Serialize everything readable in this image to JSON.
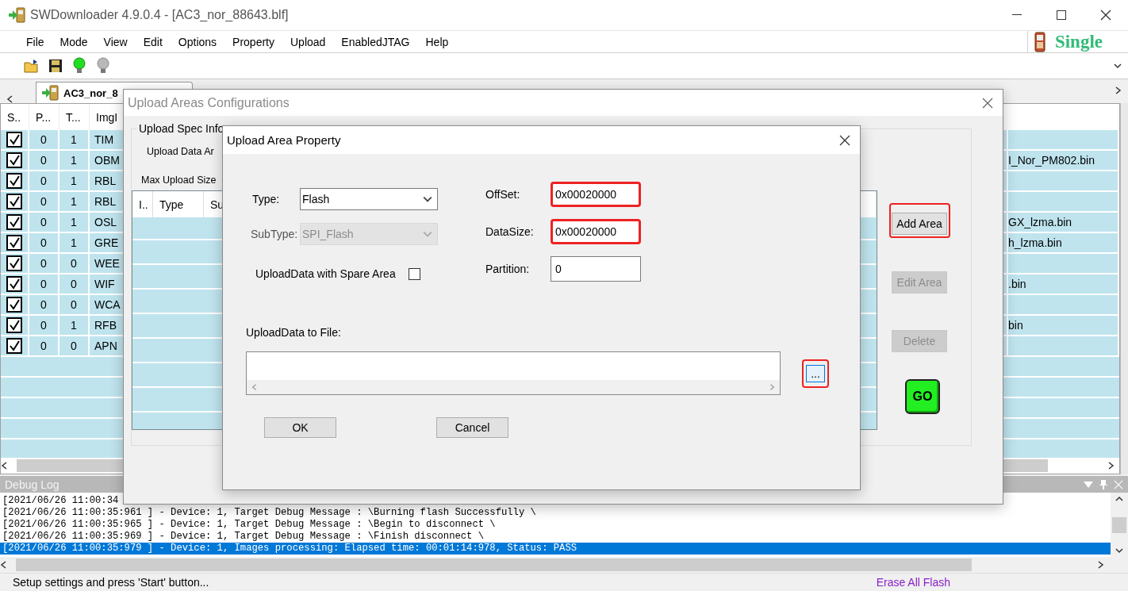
{
  "window": {
    "title": "SWDownloader 4.9.0.4 - [AC3_nor_88643.blf]"
  },
  "menu": [
    "File",
    "Mode",
    "View",
    "Edit",
    "Options",
    "Property",
    "Upload",
    "EnabledJTAG",
    "Help"
  ],
  "mode_label": "Single",
  "tab": {
    "label": "AC3_nor_8",
    "selected": true
  },
  "image_table": {
    "columns": [
      "S..",
      "P...",
      "T...",
      "ImgI"
    ],
    "rows": [
      {
        "checked": true,
        "p": "0",
        "t": "1",
        "image": "TIM"
      },
      {
        "checked": true,
        "p": "0",
        "t": "1",
        "image": "OBM",
        "file": "I_Nor_PM802.bin"
      },
      {
        "checked": true,
        "p": "0",
        "t": "1",
        "image": "RBL"
      },
      {
        "checked": true,
        "p": "0",
        "t": "1",
        "image": "RBL"
      },
      {
        "checked": true,
        "p": "0",
        "t": "1",
        "image": "OSL",
        "file": "GX_lzma.bin"
      },
      {
        "checked": true,
        "p": "0",
        "t": "1",
        "image": "GRE",
        "file": "h_lzma.bin"
      },
      {
        "checked": true,
        "p": "0",
        "t": "0",
        "image": "WEE"
      },
      {
        "checked": true,
        "p": "0",
        "t": "0",
        "image": "WIF",
        "file": ".bin"
      },
      {
        "checked": true,
        "p": "0",
        "t": "0",
        "image": "WCA"
      },
      {
        "checked": true,
        "p": "0",
        "t": "1",
        "image": "RFB",
        "file": "bin"
      },
      {
        "checked": true,
        "p": "0",
        "t": "0",
        "image": "APN"
      }
    ]
  },
  "debug_log": {
    "title": "Debug Log",
    "lines": [
      {
        "text": "[2021/06/26 11:00:34",
        "selected": false
      },
      {
        "text": "[2021/06/26 11:00:35:961 ] - Device: 1, Target Debug Message : \\Burning flash Successfully \\",
        "selected": false
      },
      {
        "text": "[2021/06/26 11:00:35:965 ] - Device: 1, Target Debug Message : \\Begin to disconnect \\",
        "selected": false
      },
      {
        "text": "[2021/06/26 11:00:35:969 ] - Device: 1, Target Debug Message : \\Finish disconnect \\",
        "selected": false
      },
      {
        "text": "[2021/06/26 11:00:35:979 ] - Device: 1, Images processing: Elapsed time: 00:01:14:978, Status: PASS",
        "selected": true
      }
    ]
  },
  "status_bar": {
    "message": "Setup settings and press 'Start' button...",
    "action": "Erase All Flash"
  },
  "upload_areas_dialog": {
    "title": "Upload Areas Configurations",
    "group_title": "Upload Spec Info",
    "labels": [
      "Upload Data Ar",
      "Max Upload Size"
    ],
    "list_columns": [
      "I..",
      "Type",
      "Su"
    ],
    "buttons": [
      {
        "label": "Add Area",
        "disabled": false,
        "highlighted": true
      },
      {
        "label": "Edit Area",
        "disabled": true,
        "highlighted": false
      },
      {
        "label": "Delete",
        "disabled": true,
        "highlighted": false
      }
    ],
    "go_button": "GO"
  },
  "upload_area_property": {
    "title": "Upload Area Property",
    "left_fields": [
      {
        "kind": "select",
        "label": "Type:",
        "value": "Flash",
        "disabled": false
      },
      {
        "kind": "select",
        "label": "SubType:",
        "value": "SPI_Flash",
        "disabled": true
      },
      {
        "kind": "checkbox",
        "label": "UploadData with Spare Area",
        "checked": false
      }
    ],
    "right_fields": [
      {
        "label": "OffSet:",
        "value": "0x00020000",
        "highlighted": true
      },
      {
        "label": "DataSize:",
        "value": "0x00020000",
        "highlighted": true
      },
      {
        "label": "Partition:",
        "value": "0",
        "highlighted": false
      }
    ],
    "file_label": "UploadData to File:",
    "browse": {
      "label": "...",
      "highlighted": true
    },
    "buttons": [
      "OK",
      "Cancel"
    ]
  }
}
